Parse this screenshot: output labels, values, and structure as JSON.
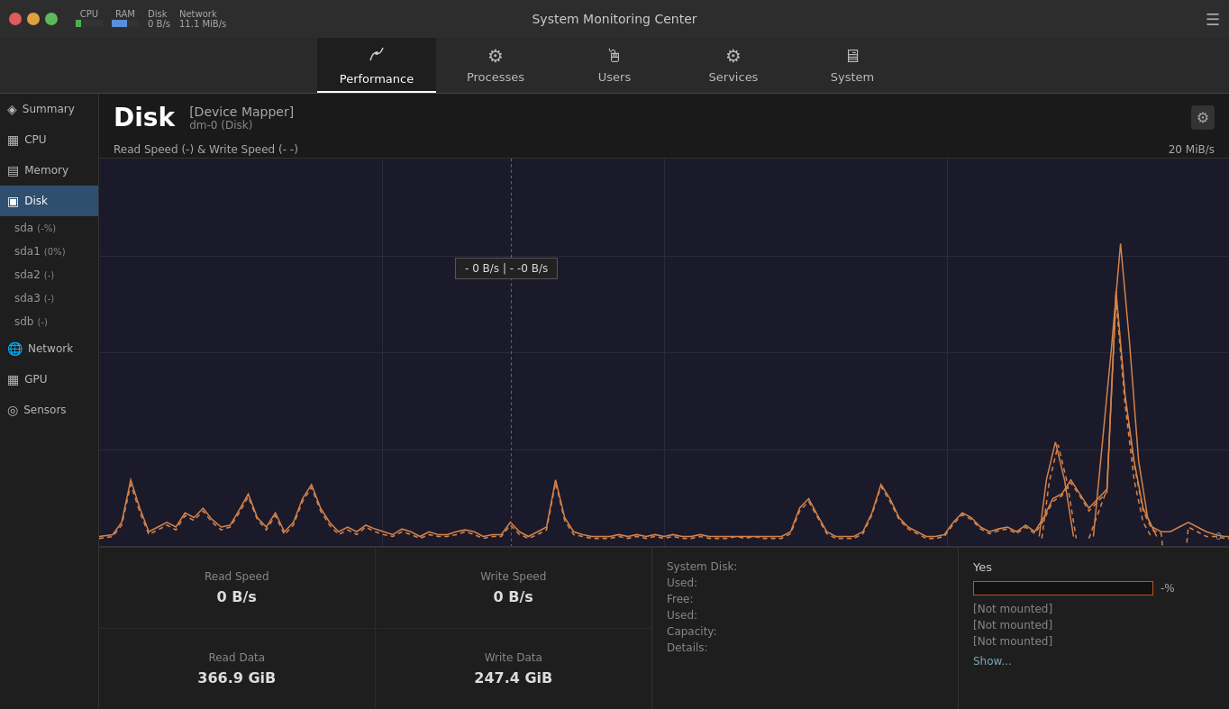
{
  "titlebar": {
    "title": "System Monitoring Center",
    "cpu_label": "CPU",
    "ram_label": "RAM",
    "disk_label": "Disk",
    "network_label": "Network",
    "network_value": "11.1 MiB/s",
    "disk_value": "0 B/s",
    "menu_icon": "☰"
  },
  "tabs": [
    {
      "id": "performance",
      "label": "Performance",
      "icon": "⚡",
      "active": true
    },
    {
      "id": "processes",
      "label": "Processes",
      "icon": "⚙",
      "active": false
    },
    {
      "id": "users",
      "label": "Users",
      "icon": "🖱",
      "active": false
    },
    {
      "id": "services",
      "label": "Services",
      "icon": "⚙",
      "active": false
    },
    {
      "id": "system",
      "label": "System",
      "icon": "🖥",
      "active": false
    }
  ],
  "sidebar": {
    "items": [
      {
        "id": "summary",
        "label": "Summary",
        "icon": "◈"
      },
      {
        "id": "cpu",
        "label": "CPU",
        "icon": "▦"
      },
      {
        "id": "memory",
        "label": "Memory",
        "icon": "▤"
      },
      {
        "id": "disk",
        "label": "Disk",
        "icon": "▣",
        "active": true
      },
      {
        "id": "sda",
        "label": "sda",
        "badge": "(-%)",
        "sub": true
      },
      {
        "id": "sda1",
        "label": "sda1",
        "badge": "(0%)",
        "sub": true
      },
      {
        "id": "sda2",
        "label": "sda2",
        "badge": "(-)",
        "sub": true
      },
      {
        "id": "sda3",
        "label": "sda3",
        "badge": "(-)",
        "sub": true
      },
      {
        "id": "sdb",
        "label": "sdb",
        "badge": "(-)",
        "sub": true
      },
      {
        "id": "network",
        "label": "Network",
        "icon": "🌐"
      },
      {
        "id": "gpu",
        "label": "GPU",
        "icon": "▦"
      },
      {
        "id": "sensors",
        "label": "Sensors",
        "icon": "◎"
      }
    ]
  },
  "content": {
    "disk_title": "Disk",
    "device_mapper": "[Device Mapper]",
    "device_id": "dm-0 (Disk)",
    "graph_label": "Read Speed (-) & Write Speed (-  -)",
    "graph_max": "20 MiB/s",
    "graph_min": "0",
    "tooltip": "- 0 B/s  |  - -0 B/s"
  },
  "stats": {
    "read_speed_label": "Read Speed",
    "read_speed_value": "0 B/s",
    "write_speed_label": "Write Speed",
    "write_speed_value": "0 B/s",
    "read_data_label": "Read Data",
    "read_data_value": "366.9 GiB",
    "write_data_label": "Write Data",
    "write_data_value": "247.4 GiB",
    "system_disk_label": "System Disk:",
    "used_label": "Used:",
    "free_label": "Free:",
    "used2_label": "Used:",
    "capacity_label": "Capacity:",
    "details_label": "Details:",
    "yes_label": "Yes",
    "percent_suffix": "-%",
    "not_mounted_1": "[Not mounted]",
    "not_mounted_2": "[Not mounted]",
    "not_mounted_3": "[Not mounted]",
    "show_link": "Show..."
  }
}
